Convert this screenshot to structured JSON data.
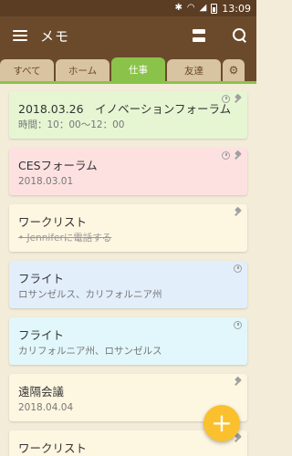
{
  "status": {
    "time": "13:09"
  },
  "appbar": {
    "title": "メモ"
  },
  "tabs": [
    {
      "label": "すべて"
    },
    {
      "label": "ホーム"
    },
    {
      "label": "仕事"
    },
    {
      "label": "友達"
    }
  ],
  "notes": [
    {
      "title": "2018.03.26　イノベーションフォーラム",
      "subtitle": "時間：10：00〜12：00",
      "color": "#e6f6d3",
      "alarm": true,
      "pin": true,
      "strike": false
    },
    {
      "title": "CESフォーラム",
      "subtitle": "2018.03.01",
      "color": "#fde1e1",
      "alarm": true,
      "pin": true,
      "strike": false
    },
    {
      "title": "ワークリスト",
      "subtitle": "• Jenniferに電話する",
      "color": "#fdf6e1",
      "alarm": false,
      "pin": true,
      "strike": true
    },
    {
      "title": "フライト",
      "subtitle": "ロサンゼルス、カリフォルニア州",
      "color": "#e3eefb",
      "alarm": true,
      "pin": false,
      "strike": false
    },
    {
      "title": "フライト",
      "subtitle": "カリフォルニア州、ロサンゼルス",
      "color": "#e1f7fb",
      "alarm": true,
      "pin": false,
      "strike": false
    },
    {
      "title": "遠隔会議",
      "subtitle": "2018.04.04",
      "color": "#fdf6e1",
      "alarm": false,
      "pin": true,
      "strike": false
    },
    {
      "title": "ワークリスト",
      "subtitle": "",
      "color": "#fdf6e1",
      "alarm": false,
      "pin": true,
      "strike": false
    }
  ],
  "fab": {
    "label": "+"
  }
}
